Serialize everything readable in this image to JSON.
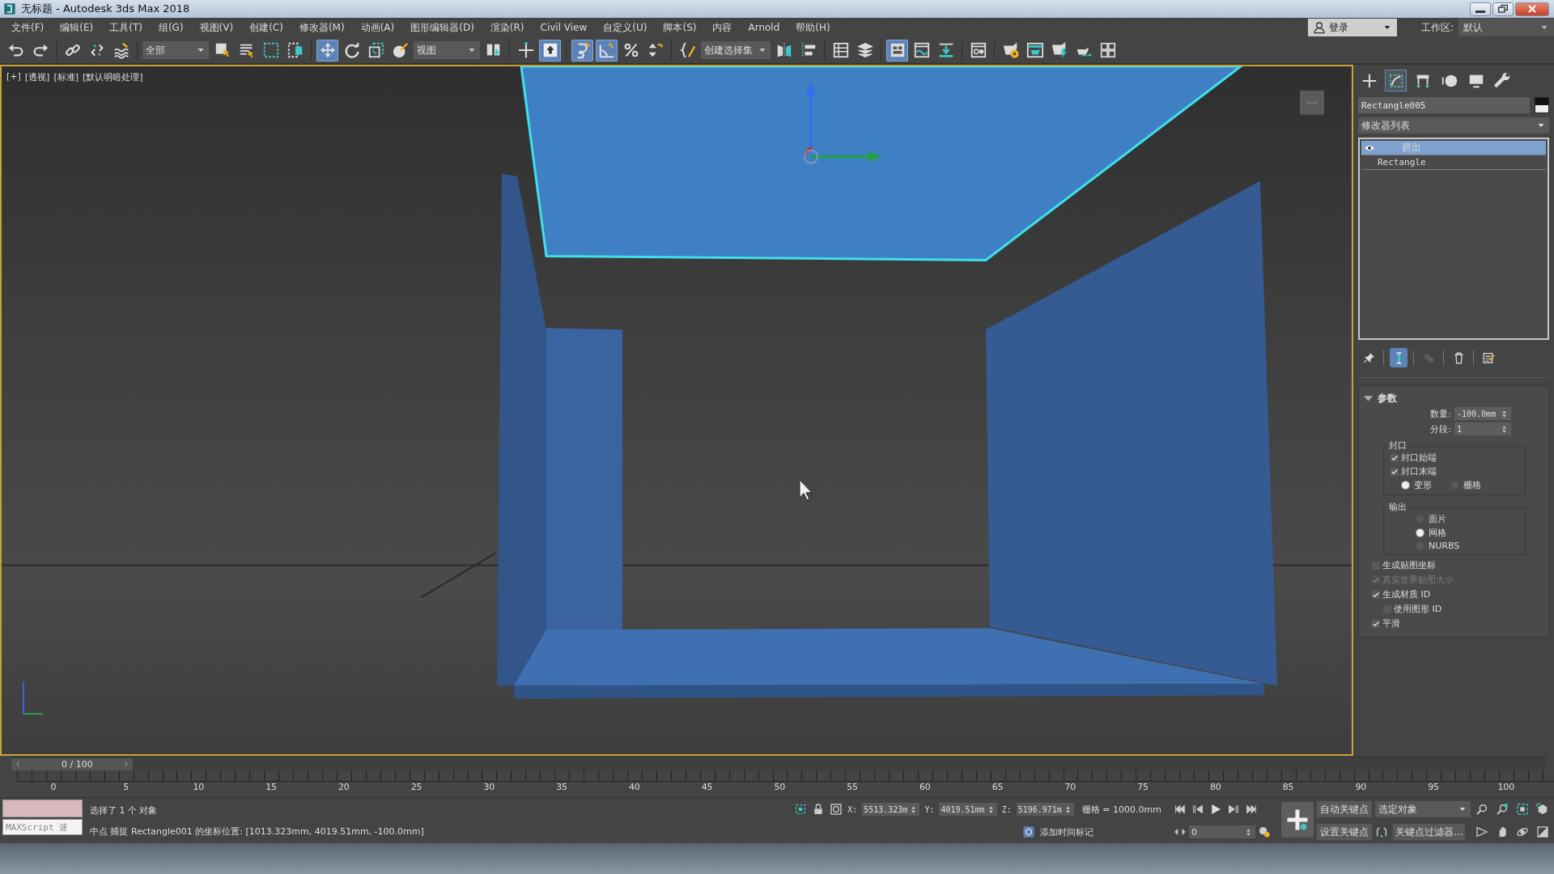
{
  "window": {
    "title": "无标题 - Autodesk 3ds Max 2018"
  },
  "menu": [
    "文件(F)",
    "编辑(E)",
    "工具(T)",
    "组(G)",
    "视图(V)",
    "创建(C)",
    "修改器(M)",
    "动画(A)",
    "图形编辑器(D)",
    "渲染(R)",
    "Civil View",
    "自定义(U)",
    "脚本(S)",
    "内容",
    "Arnold",
    "帮助(H)"
  ],
  "account": {
    "label": "登录"
  },
  "workspace": {
    "label": "工作区:",
    "value": "默认"
  },
  "toolbar": [
    {
      "kind": "undo",
      "on": false
    },
    {
      "kind": "redo",
      "on": false
    },
    {
      "kind": "sep"
    },
    {
      "kind": "link",
      "on": false
    },
    {
      "kind": "unlink",
      "on": false
    },
    {
      "kind": "bind",
      "on": false
    },
    {
      "kind": "sep"
    },
    {
      "kind": "dropdown",
      "text": "全部"
    },
    {
      "kind": "select",
      "on": false
    },
    {
      "kind": "select-name",
      "on": false
    },
    {
      "kind": "region",
      "on": false
    },
    {
      "kind": "crossing",
      "on": false
    },
    {
      "kind": "sep"
    },
    {
      "kind": "move",
      "on": true
    },
    {
      "kind": "rotate",
      "on": false
    },
    {
      "kind": "scale",
      "on": false
    },
    {
      "kind": "placement",
      "on": false
    },
    {
      "kind": "dropdown",
      "text": "视图"
    },
    {
      "kind": "pivot",
      "on": false
    },
    {
      "kind": "sep"
    },
    {
      "kind": "manipulate",
      "on": false
    },
    {
      "kind": "override",
      "on": true
    },
    {
      "kind": "sep"
    },
    {
      "kind": "snap",
      "on": true
    },
    {
      "kind": "angle",
      "on": true
    },
    {
      "kind": "percent",
      "on": false
    },
    {
      "kind": "spinner",
      "on": false
    },
    {
      "kind": "sep"
    },
    {
      "kind": "braces",
      "on": false
    },
    {
      "kind": "dropdown",
      "text": "创建选择集"
    },
    {
      "kind": "mirror",
      "on": false
    },
    {
      "kind": "align",
      "on": false
    },
    {
      "kind": "sep"
    },
    {
      "kind": "table",
      "on": false
    },
    {
      "kind": "layers",
      "on": false
    },
    {
      "kind": "sep"
    },
    {
      "kind": "ribbon",
      "on": true
    },
    {
      "kind": "curve",
      "on": false
    },
    {
      "kind": "schematic",
      "on": false
    },
    {
      "kind": "sep"
    },
    {
      "kind": "material",
      "on": false
    },
    {
      "kind": "sep"
    },
    {
      "kind": "teapot-gear",
      "on": false
    },
    {
      "kind": "teapot-frame",
      "on": false
    },
    {
      "kind": "teapot-bolt",
      "on": false
    },
    {
      "kind": "teapot",
      "on": false
    },
    {
      "kind": "tiles",
      "on": false
    }
  ],
  "viewport": {
    "active": true,
    "labels": [
      "[+]",
      "[透视]",
      "[标准]",
      "[默认明暗处理]"
    ]
  },
  "command_panel": {
    "tabs": [
      {
        "kind": "create",
        "selected": false
      },
      {
        "kind": "modify",
        "selected": true
      },
      {
        "kind": "hierarchy",
        "selected": false
      },
      {
        "kind": "motion",
        "selected": false
      },
      {
        "kind": "display",
        "selected": false
      },
      {
        "kind": "utilities",
        "selected": false
      }
    ],
    "object_name": "Rectangle005",
    "modifier_list": "修改器列表",
    "stack": [
      {
        "label": "挤出",
        "selected": true,
        "visible": true
      },
      {
        "label": "Rectangle",
        "selected": false,
        "visible": false
      }
    ],
    "stack_tools": [
      {
        "kind": "pin",
        "on": false
      },
      {
        "kind": "end-result",
        "on": true
      },
      {
        "kind": "unique",
        "on": false
      },
      {
        "kind": "remove",
        "on": false
      },
      {
        "kind": "configure",
        "on": false
      }
    ],
    "parameters": {
      "title": "参数",
      "expanded": true,
      "spinners": [
        {
          "label": "数量:",
          "value": "-100.0mm"
        },
        {
          "label": "分段:",
          "value": "1"
        }
      ],
      "groups": [
        {
          "title": "封口",
          "items": [
            {
              "kind": "checkbox",
              "label": "封口始端",
              "checked": true
            },
            {
              "kind": "checkbox",
              "label": "封口末端",
              "checked": true
            },
            {
              "kind": "radio-row",
              "options": [
                {
                  "label": "变形",
                  "selected": true
                },
                {
                  "label": "栅格",
                  "selected": false
                }
              ]
            }
          ]
        },
        {
          "title": "输出",
          "items": [
            {
              "kind": "radio",
              "label": "面片",
              "selected": false
            },
            {
              "kind": "radio",
              "label": "网格",
              "selected": true
            },
            {
              "kind": "radio",
              "label": "NURBS",
              "selected": false
            }
          ]
        }
      ],
      "options": [
        {
          "label": "生成贴图坐标",
          "checked": false,
          "disabled": false
        },
        {
          "label": "真实世界贴图大小",
          "checked": true,
          "disabled": true
        },
        {
          "label": "生成材质 ID",
          "checked": true,
          "disabled": false,
          "children": [
            {
              "label": "使用图形 ID",
              "checked": false,
              "disabled": false
            }
          ]
        },
        {
          "label": "平滑",
          "checked": true,
          "disabled": false
        }
      ]
    }
  },
  "timeline": {
    "frame": "0 / 100",
    "ruler_labels": [
      "0",
      "5",
      "10",
      "15",
      "20",
      "25",
      "30",
      "35",
      "40",
      "45",
      "50",
      "55",
      "60",
      "65",
      "70",
      "75",
      "80",
      "85",
      "90",
      "95",
      "100"
    ]
  },
  "status": {
    "listener": "MAXScript 迷",
    "selection": "选择了 1 个 对象",
    "prompt": "中点 捕捉 Rectangle001 的坐标位置: [1013.323mm, 4019.51mm, -100.0mm]",
    "coords": [
      {
        "axis": "X:",
        "value": "5513.323m"
      },
      {
        "axis": "Y:",
        "value": "4019.51mm"
      },
      {
        "axis": "Z:",
        "value": "5196.971m"
      }
    ],
    "grid": "栅格 = 1000.0mm",
    "add_time_tag": "添加时间标记",
    "current_frame": "0",
    "auto_key": "自动关键点",
    "set_key": "设置关键点",
    "key_mode": "选定对象",
    "key_filters": "关键点过滤器..."
  }
}
